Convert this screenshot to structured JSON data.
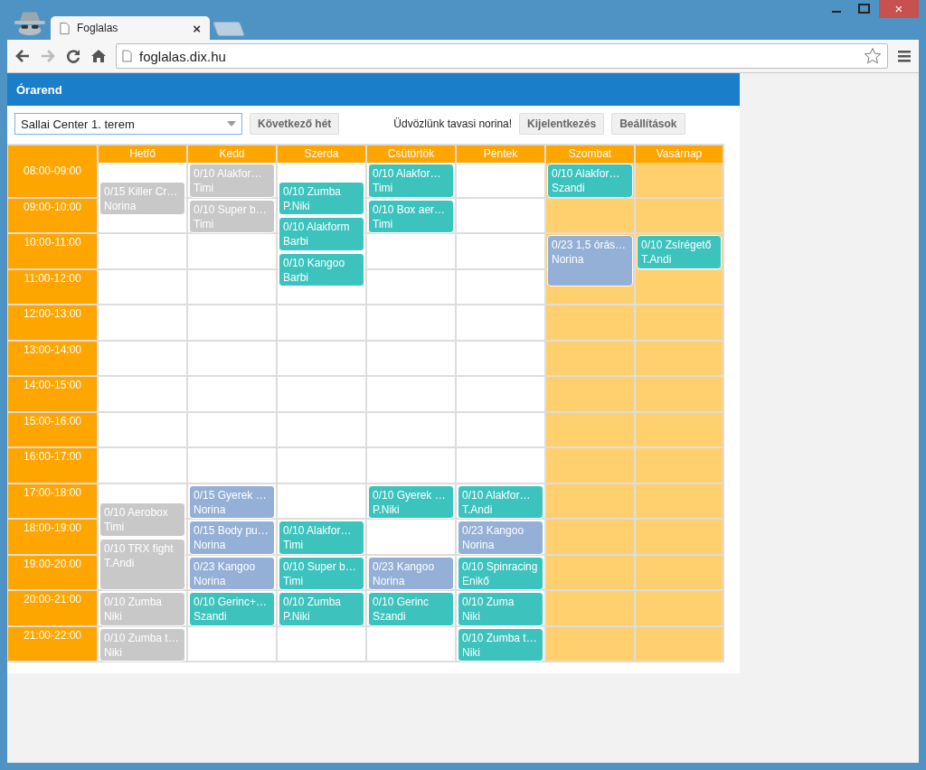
{
  "browser": {
    "tab_title": "Foglalas",
    "tab_close": "×",
    "url": "foglalas.dix.hu",
    "window_close": "×"
  },
  "header": {
    "title": "Órarend"
  },
  "toolbar": {
    "room_select": "Sallai Center 1. terem",
    "next_week": "Következő hét",
    "welcome": "Üdvözlünk tavasi norina!",
    "logout": "Kijelentkezés",
    "settings": "Beállítások"
  },
  "times": [
    "08:00-09:00",
    "09:00-10:00",
    "10:00-11:00",
    "11:00-12:00",
    "12:00-13:00",
    "13:00-14:00",
    "14:00-15:00",
    "15:00-16:00",
    "16:00-17:00",
    "17:00-18:00",
    "18:00-19:00",
    "19:00-20:00",
    "20:00-21:00",
    "21:00-22:00"
  ],
  "days": [
    {
      "name": "Hétfő",
      "slots": [
        {
          "shaded": false,
          "events": [
            {
              "title": "0/15 Killer Cr…",
              "instructor": "Norina",
              "half_past": true,
              "long": false,
              "color": "#c8c8c8"
            }
          ]
        },
        {
          "shaded": false
        },
        {
          "shaded": false
        },
        {
          "shaded": false
        },
        {
          "shaded": false
        },
        {
          "shaded": false
        },
        {
          "shaded": false
        },
        {
          "shaded": false
        },
        {
          "shaded": false
        },
        {
          "shaded": false,
          "events": [
            {
              "title": "0/10 Aerobox",
              "instructor": "Timi",
              "half_past": true,
              "long": false,
              "color": "#c8c8c8"
            }
          ]
        },
        {
          "shaded": false,
          "events": [
            {
              "title": "0/10 TRX fight",
              "instructor": "T.Andi",
              "half_past": true,
              "long": true,
              "color": "#c8c8c8"
            }
          ]
        },
        {
          "shaded": false
        },
        {
          "shaded": false,
          "events": [
            {
              "title": "0/10 Zumba",
              "instructor": "Niki",
              "half_past": false,
              "long": false,
              "color": "#c8c8c8"
            }
          ]
        },
        {
          "shaded": false,
          "events": [
            {
              "title": "0/10 Zumba t…",
              "instructor": "Niki",
              "half_past": false,
              "long": false,
              "color": "#c8c8c8"
            }
          ]
        }
      ]
    },
    {
      "name": "Kedd",
      "slots": [
        {
          "shaded": false,
          "events": [
            {
              "title": "0/10 Alakfor…",
              "instructor": "Timi",
              "half_past": false,
              "long": false,
              "color": "#c8c8c8"
            }
          ]
        },
        {
          "shaded": false,
          "events": [
            {
              "title": "0/10 Super b…",
              "instructor": "Timi",
              "half_past": false,
              "long": false,
              "color": "#c8c8c8"
            }
          ]
        },
        {
          "shaded": false
        },
        {
          "shaded": false
        },
        {
          "shaded": false
        },
        {
          "shaded": false
        },
        {
          "shaded": false
        },
        {
          "shaded": false
        },
        {
          "shaded": false
        },
        {
          "shaded": false,
          "events": [
            {
              "title": "0/15 Gyerek …",
              "instructor": "Norina",
              "half_past": false,
              "long": false,
              "color": "#94b0d6"
            }
          ]
        },
        {
          "shaded": false,
          "events": [
            {
              "title": "0/15 Body pu…",
              "instructor": "Norina",
              "half_past": false,
              "long": false,
              "color": "#94b0d6"
            }
          ]
        },
        {
          "shaded": false,
          "events": [
            {
              "title": "0/23 Kangoo",
              "instructor": "Norina",
              "half_past": false,
              "long": false,
              "color": "#94b0d6"
            }
          ]
        },
        {
          "shaded": false,
          "events": [
            {
              "title": "0/10 Gerinc+…",
              "instructor": "Szandi",
              "half_past": false,
              "long": false,
              "color": "#3cc3be"
            }
          ]
        },
        {
          "shaded": false
        }
      ]
    },
    {
      "name": "Szerda",
      "slots": [
        {
          "shaded": false,
          "events": [
            {
              "title": "0/10 Zumba",
              "instructor": "P.Niki",
              "half_past": true,
              "long": false,
              "color": "#3cc3be"
            }
          ]
        },
        {
          "shaded": false,
          "events": [
            {
              "title": "0/10 Alakform",
              "instructor": "Barbi",
              "half_past": true,
              "long": false,
              "color": "#3cc3be"
            }
          ]
        },
        {
          "shaded": false,
          "events": [
            {
              "title": "0/10 Kangoo",
              "instructor": "Barbi",
              "half_past": true,
              "long": false,
              "color": "#3cc3be"
            }
          ]
        },
        {
          "shaded": false
        },
        {
          "shaded": false
        },
        {
          "shaded": false
        },
        {
          "shaded": false
        },
        {
          "shaded": false
        },
        {
          "shaded": false
        },
        {
          "shaded": false
        },
        {
          "shaded": false,
          "events": [
            {
              "title": "0/10 Alakfor…",
              "instructor": "Timi",
              "half_past": false,
              "long": false,
              "color": "#3cc3be"
            }
          ]
        },
        {
          "shaded": false,
          "events": [
            {
              "title": "0/10 Super b…",
              "instructor": "Timi",
              "half_past": false,
              "long": false,
              "color": "#3cc3be"
            }
          ]
        },
        {
          "shaded": false,
          "events": [
            {
              "title": "0/10 Zumba",
              "instructor": "P.Niki",
              "half_past": false,
              "long": false,
              "color": "#3cc3be"
            }
          ]
        },
        {
          "shaded": false
        }
      ]
    },
    {
      "name": "Csütörtök",
      "slots": [
        {
          "shaded": false,
          "events": [
            {
              "title": "0/10 Alakfor…",
              "instructor": "Timi",
              "half_past": false,
              "long": false,
              "color": "#3cc3be"
            }
          ]
        },
        {
          "shaded": false,
          "events": [
            {
              "title": "0/10 Box aer…",
              "instructor": "Timi",
              "half_past": false,
              "long": false,
              "color": "#3cc3be"
            }
          ]
        },
        {
          "shaded": false
        },
        {
          "shaded": false
        },
        {
          "shaded": false
        },
        {
          "shaded": false
        },
        {
          "shaded": false
        },
        {
          "shaded": false
        },
        {
          "shaded": false
        },
        {
          "shaded": false,
          "events": [
            {
              "title": "0/10 Gyerek …",
              "instructor": "P.Niki",
              "half_past": false,
              "long": false,
              "color": "#3cc3be"
            }
          ]
        },
        {
          "shaded": false
        },
        {
          "shaded": false,
          "events": [
            {
              "title": "0/23 Kangoo",
              "instructor": "Norina",
              "half_past": false,
              "long": false,
              "color": "#94b0d6"
            }
          ]
        },
        {
          "shaded": false,
          "events": [
            {
              "title": "0/10 Gerinc",
              "instructor": "Szandi",
              "half_past": false,
              "long": false,
              "color": "#3cc3be"
            }
          ]
        },
        {
          "shaded": false
        }
      ]
    },
    {
      "name": "Péntek",
      "slots": [
        {
          "shaded": false
        },
        {
          "shaded": false
        },
        {
          "shaded": false
        },
        {
          "shaded": false
        },
        {
          "shaded": false
        },
        {
          "shaded": false
        },
        {
          "shaded": false
        },
        {
          "shaded": false
        },
        {
          "shaded": false
        },
        {
          "shaded": false,
          "events": [
            {
              "title": "0/10 Alakfor…",
              "instructor": "T.Andi",
              "half_past": false,
              "long": false,
              "color": "#3cc3be"
            }
          ]
        },
        {
          "shaded": false,
          "events": [
            {
              "title": "0/23 Kangoo",
              "instructor": "Norina",
              "half_past": false,
              "long": false,
              "color": "#94b0d6"
            }
          ]
        },
        {
          "shaded": false,
          "events": [
            {
              "title": "0/10 Spinracing",
              "instructor": "Enikő",
              "half_past": false,
              "long": false,
              "color": "#3cc3be"
            }
          ]
        },
        {
          "shaded": false,
          "events": [
            {
              "title": "0/10 Zuma",
              "instructor": "Niki",
              "half_past": false,
              "long": false,
              "color": "#3cc3be"
            }
          ]
        },
        {
          "shaded": false,
          "events": [
            {
              "title": "0/10 Zumba t…",
              "instructor": "Niki",
              "half_past": false,
              "long": false,
              "color": "#3cc3be"
            }
          ]
        }
      ]
    },
    {
      "name": "Szombat",
      "slots": [
        {
          "shaded": true,
          "events": [
            {
              "title": "0/10 Alakfor…",
              "instructor": "Szandi",
              "half_past": false,
              "long": false,
              "color": "#3cc3be"
            }
          ]
        },
        {
          "shaded": true
        },
        {
          "shaded": true,
          "events": [
            {
              "title": "0/23 1,5 órás…",
              "instructor": "Norina",
              "half_past": false,
              "long": true,
              "color": "#94b0d6"
            }
          ]
        },
        {
          "shaded": true
        },
        {
          "shaded": true
        },
        {
          "shaded": true
        },
        {
          "shaded": true
        },
        {
          "shaded": true
        },
        {
          "shaded": true
        },
        {
          "shaded": true
        },
        {
          "shaded": true
        },
        {
          "shaded": true
        },
        {
          "shaded": true
        },
        {
          "shaded": true
        }
      ]
    },
    {
      "name": "Vasárnap",
      "slots": [
        {
          "shaded": true
        },
        {
          "shaded": true
        },
        {
          "shaded": true,
          "events": [
            {
              "title": "0/10 Zsírégető",
              "instructor": "T.Andi",
              "half_past": false,
              "long": false,
              "color": "#3cc3be"
            }
          ]
        },
        {
          "shaded": true
        },
        {
          "shaded": true
        },
        {
          "shaded": true
        },
        {
          "shaded": true
        },
        {
          "shaded": true
        },
        {
          "shaded": true
        },
        {
          "shaded": true
        },
        {
          "shaded": true
        },
        {
          "shaded": true
        },
        {
          "shaded": true
        },
        {
          "shaded": true
        }
      ]
    }
  ]
}
